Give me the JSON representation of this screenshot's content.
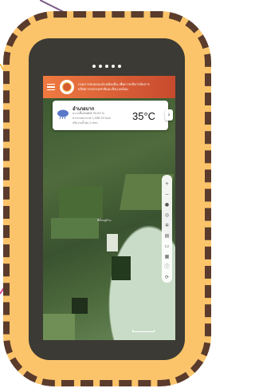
{
  "app": {
    "header_title_line1": "กรมการปกครองส่วนท้องถิ่น เพื่อการบริหารจัดการ",
    "header_title_line2": "ทรัพยากรธรรมชาติและสิ่งแวดล้อม"
  },
  "weather_card": {
    "location": "อำเภอบาก",
    "line1": "ความชื้นสัมพัทธ์ 50.63 %",
    "line2": "ความกดอากาศ 1,008.53 hpa",
    "line3": "ปริมาณน้ำฝน 0 mm",
    "temperature": "35°C",
    "icon": "cloud-rain-icon"
  },
  "map": {
    "place_label": "ที่ตั้งหมู่บ้าน",
    "tools": [
      "zoom-in-icon",
      "zoom-out-icon",
      "locate-icon",
      "target-icon",
      "gear-icon",
      "layers-icon",
      "print-icon",
      "ruler-icon",
      "info-icon",
      "reset-icon"
    ]
  },
  "colors": {
    "badge_bg": "#fbc46b",
    "badge_border": "#5a3b2c",
    "header_start": "#ef7a41",
    "header_end": "#c84a2e",
    "deco_purple": "#7a5a8a",
    "deco_pink": "#e0448a"
  }
}
